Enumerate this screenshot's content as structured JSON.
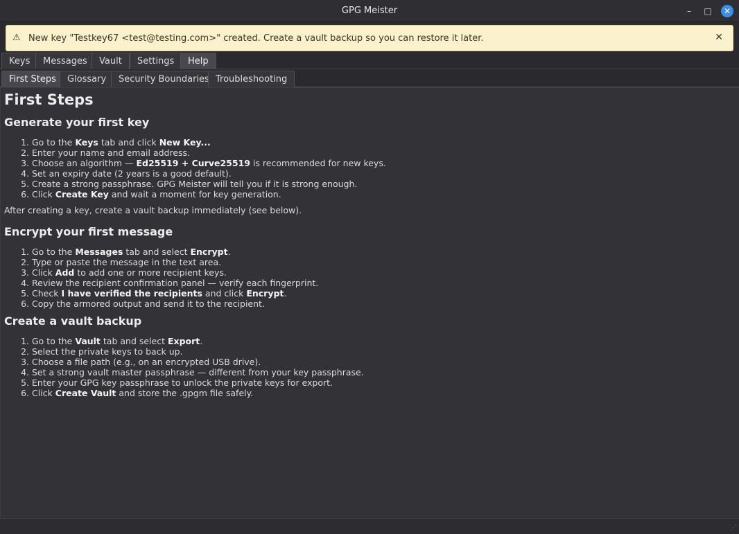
{
  "window": {
    "title": "GPG Meister",
    "min_glyph": "–",
    "max_glyph": "□",
    "close_glyph": "✕"
  },
  "banner": {
    "icon": "⚠",
    "message": "New key \"Testkey67 <test@testing.com>\" created. Create a vault backup so you can restore it later.",
    "close_glyph": "✕"
  },
  "main_tabs": [
    "Keys",
    "Messages",
    "Vault",
    "Settings",
    "Help"
  ],
  "help_tabs": [
    "First Steps",
    "Glossary",
    "Security Boundaries",
    "Troubleshooting"
  ],
  "page": {
    "title": "First Steps",
    "section1": {
      "heading": "Generate your first key",
      "steps": [
        [
          "Go to the ",
          {
            "b": "Keys"
          },
          " tab and click ",
          {
            "b": "New Key..."
          }
        ],
        [
          "Enter your name and email address."
        ],
        [
          "Choose an algorithm — ",
          {
            "b": "Ed25519 + Curve25519"
          },
          " is recommended for new keys."
        ],
        [
          "Set an expiry date (2 years is a good default)."
        ],
        [
          "Create a strong passphrase. GPG Meister will tell you if it is strong enough."
        ],
        [
          "Click ",
          {
            "b": "Create Key"
          },
          " and wait a moment for key generation."
        ]
      ],
      "note": "After creating a key, create a vault backup immediately (see below)."
    },
    "section2": {
      "heading": "Encrypt your first message",
      "steps": [
        [
          "Go to the ",
          {
            "b": "Messages"
          },
          " tab and select ",
          {
            "b": "Encrypt"
          },
          "."
        ],
        [
          "Type or paste the message in the text area."
        ],
        [
          "Click ",
          {
            "b": "Add"
          },
          " to add one or more recipient keys."
        ],
        [
          "Review the recipient confirmation panel — verify each fingerprint."
        ],
        [
          "Check ",
          {
            "b": "I have verified the recipients"
          },
          " and click ",
          {
            "b": "Encrypt"
          },
          "."
        ],
        [
          "Copy the armored output and send it to the recipient."
        ]
      ]
    },
    "section3": {
      "heading": "Create a vault backup",
      "steps": [
        [
          "Go to the ",
          {
            "b": "Vault"
          },
          " tab and select ",
          {
            "b": "Export"
          },
          "."
        ],
        [
          "Select the private keys to back up."
        ],
        [
          "Choose a file path (e.g., on an encrypted USB drive)."
        ],
        [
          "Set a strong vault master passphrase — different from your key passphrase."
        ],
        [
          "Enter your GPG key passphrase to unlock the private keys for export."
        ],
        [
          "Click ",
          {
            "b": "Create Vault"
          },
          " and store the .gpgm file safely."
        ]
      ]
    }
  },
  "colors": {
    "banner_bg": "#fbf1cc",
    "accent_close": "#3d8ee6",
    "content_bg": "#323237"
  }
}
